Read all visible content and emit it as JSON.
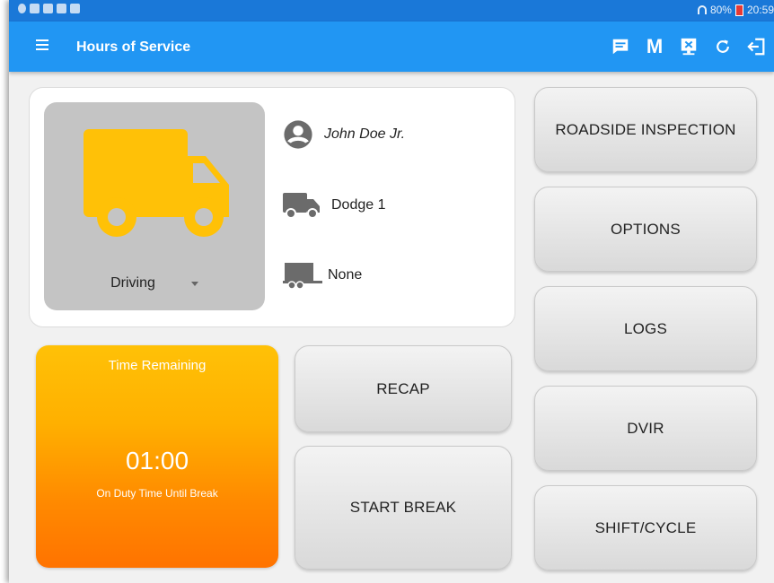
{
  "statusbar": {
    "battery_text": "80%",
    "time": "20:59"
  },
  "appbar": {
    "title": "Hours of Service",
    "m_label": "M"
  },
  "driver": {
    "name": "John Doe Jr.",
    "vehicle": "Dodge 1",
    "trailer": "None",
    "duty_status": "Driving"
  },
  "timer": {
    "title": "Time Remaining",
    "value": "01:00",
    "subtitle": "On Duty Time Until Break"
  },
  "buttons": {
    "recap": "RECAP",
    "start_break": "START BREAK",
    "roadside": "ROADSIDE INSPECTION",
    "options": "OPTIONS",
    "logs": "LOGS",
    "dvir": "DVIR",
    "shift_cycle": "SHIFT/CYCLE"
  },
  "colors": {
    "appbar": "#2196f3",
    "statusbar": "#1a78d8",
    "truck": "#ffc107",
    "timer_top": "#ffc107",
    "timer_bottom": "#ff7300"
  },
  "icons": {
    "menu": "menu-icon",
    "messages": "message-icon",
    "m": "m-icon",
    "eld": "eld-icon",
    "refresh": "refresh-icon",
    "logout": "logout-icon",
    "avatar": "account-circle-icon",
    "vehicle": "truck-icon",
    "trailer": "trailer-icon"
  }
}
